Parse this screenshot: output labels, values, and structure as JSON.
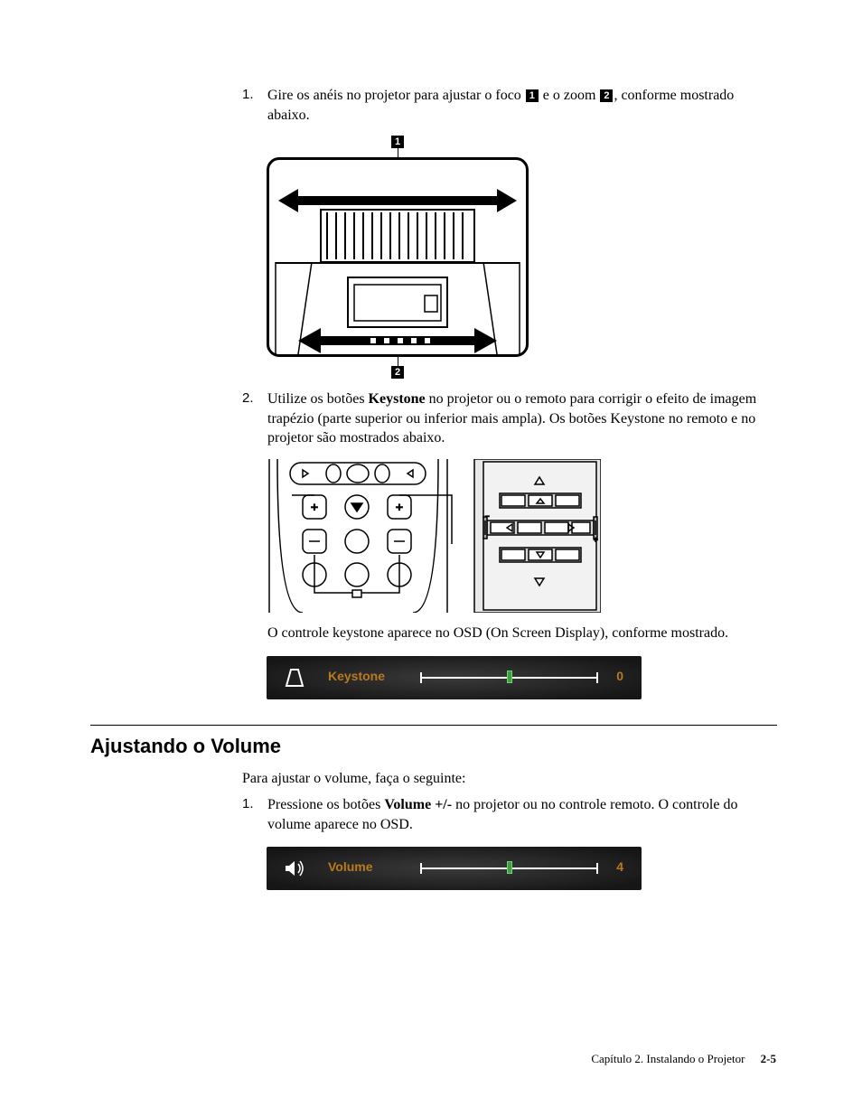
{
  "step1": {
    "num": "1.",
    "text_before_callout1": "Gire os anéis no projetor para ajustar o foco ",
    "callout1": "1",
    "text_between": " e o zoom ",
    "callout2": "2",
    "text_after": ", conforme mostrado abaixo."
  },
  "fig1": {
    "top_callout": "1",
    "bottom_callout": "2"
  },
  "step2": {
    "num": "2.",
    "text_before_bold": "Utilize os botões ",
    "bold": "Keystone",
    "text_after_bold": " no projetor ou o remoto para corrigir o efeito de imagem trapézio (parte superior ou inferior mais ampla). Os botões Keystone no remoto e no projetor são mostrados abaixo."
  },
  "osd_caption": "O controle keystone aparece no OSD (On Screen Display), conforme mostrado.",
  "osd1": {
    "label": "Keystone",
    "value": "0",
    "thumb_percent": 50
  },
  "section_heading": "Ajustando o Volume",
  "volume_intro": "Para ajustar o volume, faça o seguinte:",
  "vol_step1": {
    "num": "1.",
    "text_before_bold": "Pressione os botões ",
    "bold": "Volume +/-",
    "text_after_bold": " no projetor ou no controle remoto. O controle do volume aparece no OSD."
  },
  "osd2": {
    "label": "Volume",
    "value": "4",
    "thumb_percent": 50
  },
  "footer": {
    "chapter": "Capítulo 2. Instalando o Projetor",
    "page": "2-5"
  }
}
